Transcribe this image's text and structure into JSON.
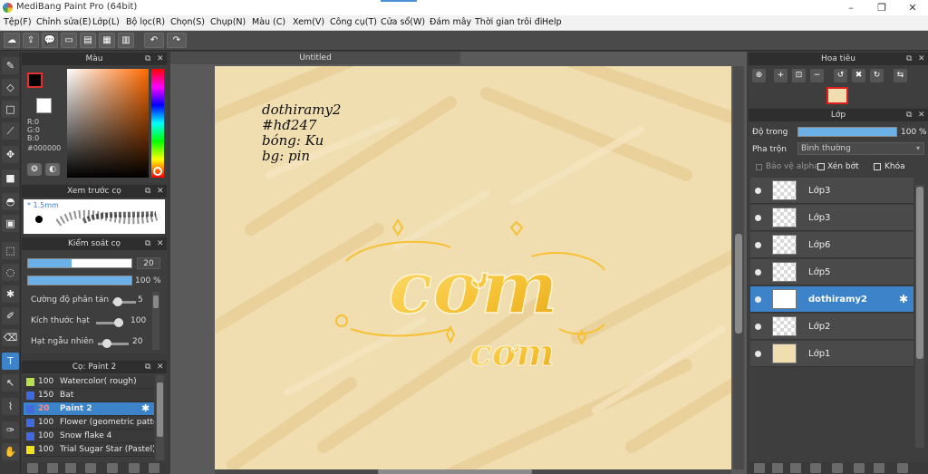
{
  "window": {
    "title": "MediBang Paint Pro (64bit)",
    "minimize": "–",
    "maximize": "❐",
    "close": "✕"
  },
  "menu": [
    "Tệp(F)",
    "Chỉnh sửa(E)",
    "Lớp(L)",
    "Bộ lọc(R)",
    "Chọn(S)",
    "Chụp(N)",
    "Màu (C)",
    "Xem(V)",
    "Công cụ(T)",
    "Cửa sổ(W)",
    "Đám mây",
    "Thời gian trôi đi",
    "Help"
  ],
  "toolbar": {
    "undo_icon": "undo-icon",
    "redo_icon": "redo-icon",
    "undo_glyph": "↶",
    "redo_glyph": "↷"
  },
  "color_panel": {
    "title": "Màu",
    "r": "R:0",
    "g": "G:0",
    "b": "B:0",
    "hex": "#000000",
    "foreground": "#000000",
    "background": "#ffffff"
  },
  "preview_panel": {
    "title": "Xem trước cọ",
    "size": "* 1.5mm"
  },
  "control_panel": {
    "title": "Kiểm soát cọ",
    "size_value": "20",
    "size_fraction": 0.42,
    "opacity_value": "100 %",
    "opacity_fraction": 1.0,
    "sliders": [
      {
        "label": "Cường độ phân tán",
        "value": "5",
        "fraction": 0.05
      },
      {
        "label": "Kích thước hạt",
        "value": "100",
        "fraction": 1.0
      },
      {
        "label": "Hạt ngẫu nhiên",
        "value": "20",
        "fraction": 0.2
      }
    ]
  },
  "brush_panel": {
    "title": "Cọ: Paint 2",
    "brushes": [
      {
        "size": "100",
        "name": "Watercolor( rough)",
        "color": "#b7e14b"
      },
      {
        "size": "150",
        "name": "Bat",
        "color": "#4169e1"
      },
      {
        "size": "20",
        "name": "Paint 2",
        "color": "#4169e1",
        "active": true
      },
      {
        "size": "100",
        "name": "Flower (geometric patte",
        "color": "#4169e1"
      },
      {
        "size": "100",
        "name": "Snow flake 4",
        "color": "#4169e1"
      },
      {
        "size": "100",
        "name": "Trial Sugar Star (Pastel)",
        "color": "#f2e11c"
      }
    ]
  },
  "canvas": {
    "tab": "Untitled",
    "notes": [
      "dothiramy2",
      "#hđ247",
      "bóng: Ku",
      "bg: pin"
    ],
    "art_main": "cơm",
    "art_sub": "cơm",
    "bg_color": "#f0ddb0"
  },
  "navigator": {
    "title": "Hoa tiêu"
  },
  "layer_panel": {
    "title": "Lớp",
    "opacity_label": "Độ trong",
    "opacity_value": "100 %",
    "blend_label": "Pha trộn",
    "blend_value": "Bình thường",
    "protect_alpha": "Bảo vệ alpha",
    "clipping": "Xén bớt",
    "lock": "Khóa",
    "layers": [
      {
        "name": "Lớp3"
      },
      {
        "name": "Lớp3"
      },
      {
        "name": "Lớp6"
      },
      {
        "name": "Lớp5"
      },
      {
        "name": "dothiramy2",
        "active": true
      },
      {
        "name": "Lớp2"
      },
      {
        "name": "Lớp1"
      }
    ]
  }
}
